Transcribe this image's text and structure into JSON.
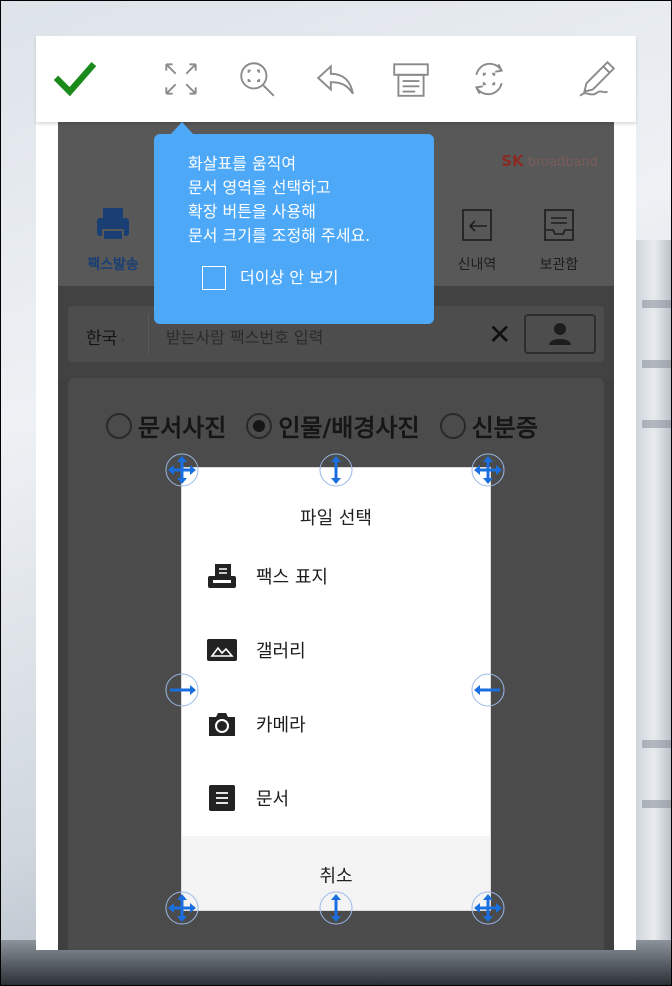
{
  "toolbar": {
    "icons": [
      "check-icon",
      "fullscreen-icon",
      "zoom-icon",
      "undo-icon",
      "print-icon",
      "rotate-icon",
      "pen-icon"
    ],
    "accent_color": "#1a8a1a"
  },
  "app": {
    "logo_sk": "SK",
    "logo_text": "broadband",
    "nav": [
      {
        "label": "팩스발송",
        "active": true
      },
      {
        "label": "신내역",
        "active": false
      },
      {
        "label": "보관함",
        "active": false
      }
    ],
    "country": "한국",
    "fax_placeholder": "받는사람 팩스번호 입력",
    "radio_options": [
      {
        "label": "문서사진",
        "selected": false
      },
      {
        "label": "인물/배경사진",
        "selected": true
      },
      {
        "label": "신분증",
        "selected": false
      }
    ]
  },
  "tooltip": {
    "lines": [
      "화살표를 움직여",
      "문서 영역을 선택하고",
      "확장 버튼을 사용해",
      "문서 크기를 조정해 주세요."
    ],
    "checkbox_label": "더이상 안 보기",
    "color": "#4da8f8"
  },
  "sheet": {
    "title": "파일 선택",
    "items": [
      "팩스 표지",
      "갤러리",
      "카메라",
      "문서"
    ],
    "cancel": "취소"
  },
  "handle_color": "#1a6fe0"
}
